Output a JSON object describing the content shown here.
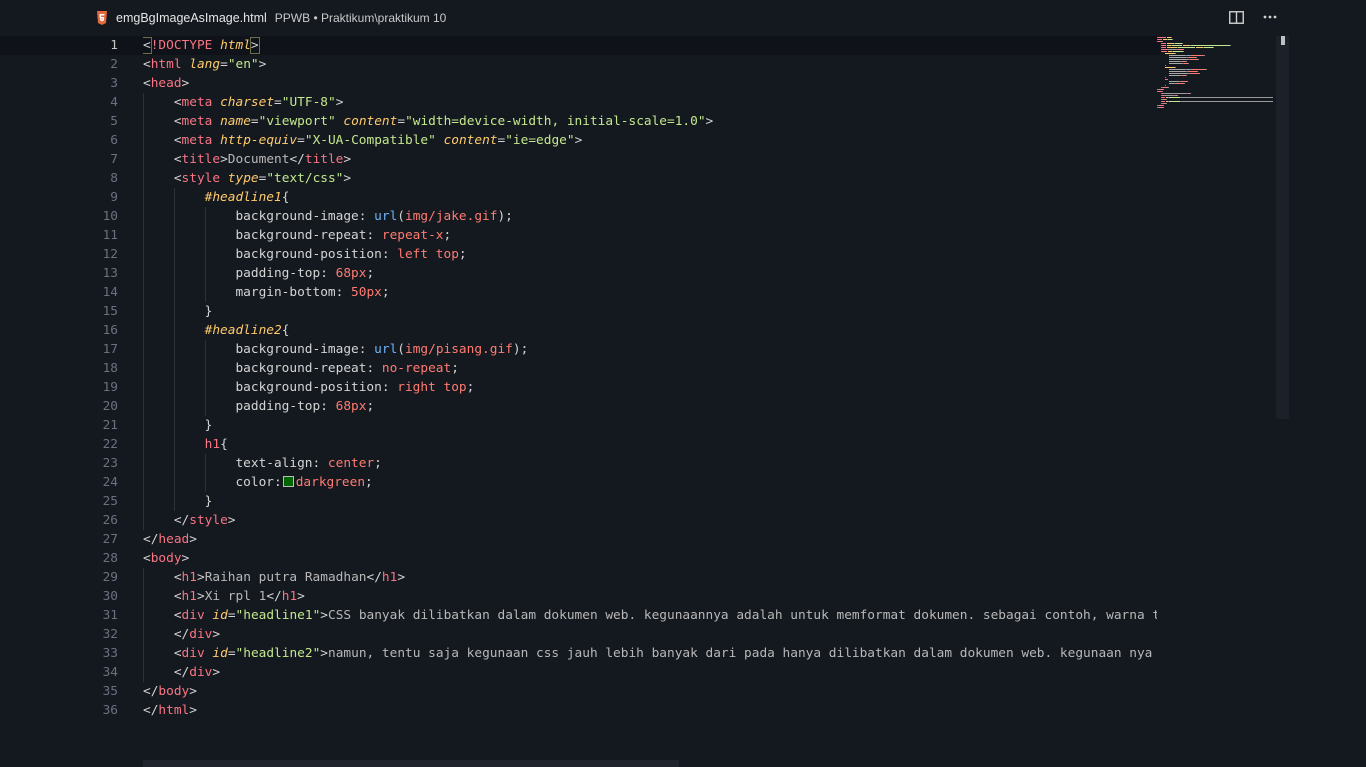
{
  "tab": {
    "filename": "emgBgImageAsImage.html",
    "path": "PPWB • Praktikum\\praktikum 10"
  },
  "toolbar": {
    "split_icon": "split-editor-icon",
    "more_icon": "more-actions-icon"
  },
  "colors": {
    "background": "#14181f",
    "tag": "#f97583",
    "attribute": "#ffcb6b",
    "string": "#c3e88d",
    "css_value": "#ff7b72",
    "css_function": "#6fb3f7",
    "darkgreen_swatch": "#006400"
  },
  "editor": {
    "active_line": 1,
    "lines": [
      {
        "num": "1",
        "tokens": [
          {
            "t": "<",
            "c": "punc",
            "m": 1
          },
          {
            "t": "!DOCTYPE",
            "c": "tag"
          },
          {
            "t": " "
          },
          {
            "t": "html",
            "c": "attr"
          },
          {
            "t": ">",
            "c": "punc",
            "m": 1
          }
        ]
      },
      {
        "num": "2",
        "tokens": [
          {
            "t": "<",
            "c": "punc"
          },
          {
            "t": "html",
            "c": "tag"
          },
          {
            "t": " "
          },
          {
            "t": "lang",
            "c": "attr"
          },
          {
            "t": "=",
            "c": "punc"
          },
          {
            "t": "\"en\"",
            "c": "str"
          },
          {
            "t": ">",
            "c": "punc"
          }
        ]
      },
      {
        "num": "3",
        "tokens": [
          {
            "t": "<",
            "c": "punc"
          },
          {
            "t": "head",
            "c": "tag"
          },
          {
            "t": ">",
            "c": "punc"
          }
        ]
      },
      {
        "num": "4",
        "tokens": [
          {
            "t": "    "
          },
          {
            "t": "<",
            "c": "punc"
          },
          {
            "t": "meta",
            "c": "tag"
          },
          {
            "t": " "
          },
          {
            "t": "charset",
            "c": "attr"
          },
          {
            "t": "=",
            "c": "punc"
          },
          {
            "t": "\"UTF-8\"",
            "c": "str"
          },
          {
            "t": ">",
            "c": "punc"
          }
        ]
      },
      {
        "num": "5",
        "tokens": [
          {
            "t": "    "
          },
          {
            "t": "<",
            "c": "punc"
          },
          {
            "t": "meta",
            "c": "tag"
          },
          {
            "t": " "
          },
          {
            "t": "name",
            "c": "attr"
          },
          {
            "t": "=",
            "c": "punc"
          },
          {
            "t": "\"viewport\"",
            "c": "str"
          },
          {
            "t": " "
          },
          {
            "t": "content",
            "c": "attr"
          },
          {
            "t": "=",
            "c": "punc"
          },
          {
            "t": "\"width=device-width, initial-scale=1.0\"",
            "c": "str"
          },
          {
            "t": ">",
            "c": "punc"
          }
        ]
      },
      {
        "num": "6",
        "tokens": [
          {
            "t": "    "
          },
          {
            "t": "<",
            "c": "punc"
          },
          {
            "t": "meta",
            "c": "tag"
          },
          {
            "t": " "
          },
          {
            "t": "http-equiv",
            "c": "attr"
          },
          {
            "t": "=",
            "c": "punc"
          },
          {
            "t": "\"X-UA-Compatible\"",
            "c": "str"
          },
          {
            "t": " "
          },
          {
            "t": "content",
            "c": "attr"
          },
          {
            "t": "=",
            "c": "punc"
          },
          {
            "t": "\"ie=edge\"",
            "c": "str"
          },
          {
            "t": ">",
            "c": "punc"
          }
        ]
      },
      {
        "num": "7",
        "tokens": [
          {
            "t": "    "
          },
          {
            "t": "<",
            "c": "punc"
          },
          {
            "t": "title",
            "c": "tag"
          },
          {
            "t": ">",
            "c": "punc"
          },
          {
            "t": "Document",
            "c": "text"
          },
          {
            "t": "</",
            "c": "punc"
          },
          {
            "t": "title",
            "c": "tag"
          },
          {
            "t": ">",
            "c": "punc"
          }
        ]
      },
      {
        "num": "8",
        "tokens": [
          {
            "t": "    "
          },
          {
            "t": "<",
            "c": "punc"
          },
          {
            "t": "style",
            "c": "tag"
          },
          {
            "t": " "
          },
          {
            "t": "type",
            "c": "attr"
          },
          {
            "t": "=",
            "c": "punc"
          },
          {
            "t": "\"text/css\"",
            "c": "str"
          },
          {
            "t": ">",
            "c": "punc"
          }
        ]
      },
      {
        "num": "9",
        "tokens": [
          {
            "t": "        "
          },
          {
            "t": "#headline1",
            "c": "sel"
          },
          {
            "t": "{",
            "c": "punc"
          }
        ]
      },
      {
        "num": "10",
        "tokens": [
          {
            "t": "            "
          },
          {
            "t": "background-image",
            "c": "prop"
          },
          {
            "t": ": ",
            "c": "punc"
          },
          {
            "t": "url",
            "c": "fn"
          },
          {
            "t": "(",
            "c": "punc"
          },
          {
            "t": "img/jake.gif",
            "c": "val"
          },
          {
            "t": ");",
            "c": "punc"
          }
        ]
      },
      {
        "num": "11",
        "tokens": [
          {
            "t": "            "
          },
          {
            "t": "background-repeat",
            "c": "prop"
          },
          {
            "t": ": ",
            "c": "punc"
          },
          {
            "t": "repeat-x",
            "c": "val"
          },
          {
            "t": ";",
            "c": "punc"
          }
        ]
      },
      {
        "num": "12",
        "tokens": [
          {
            "t": "            "
          },
          {
            "t": "background-position",
            "c": "prop"
          },
          {
            "t": ": ",
            "c": "punc"
          },
          {
            "t": "left top",
            "c": "val"
          },
          {
            "t": ";",
            "c": "punc"
          }
        ]
      },
      {
        "num": "13",
        "tokens": [
          {
            "t": "            "
          },
          {
            "t": "padding-top",
            "c": "prop"
          },
          {
            "t": ": ",
            "c": "punc"
          },
          {
            "t": "68px",
            "c": "val"
          },
          {
            "t": ";",
            "c": "punc"
          }
        ]
      },
      {
        "num": "14",
        "tokens": [
          {
            "t": "            "
          },
          {
            "t": "margin-bottom",
            "c": "prop"
          },
          {
            "t": ": ",
            "c": "punc"
          },
          {
            "t": "50px",
            "c": "val"
          },
          {
            "t": ";",
            "c": "punc"
          }
        ]
      },
      {
        "num": "15",
        "tokens": [
          {
            "t": "        "
          },
          {
            "t": "}",
            "c": "punc"
          }
        ]
      },
      {
        "num": "16",
        "tokens": [
          {
            "t": "        "
          },
          {
            "t": "#headline2",
            "c": "sel"
          },
          {
            "t": "{",
            "c": "punc"
          }
        ]
      },
      {
        "num": "17",
        "tokens": [
          {
            "t": "            "
          },
          {
            "t": "background-image",
            "c": "prop"
          },
          {
            "t": ": ",
            "c": "punc"
          },
          {
            "t": "url",
            "c": "fn"
          },
          {
            "t": "(",
            "c": "punc"
          },
          {
            "t": "img/pisang.gif",
            "c": "val"
          },
          {
            "t": ");",
            "c": "punc"
          }
        ]
      },
      {
        "num": "18",
        "tokens": [
          {
            "t": "            "
          },
          {
            "t": "background-repeat",
            "c": "prop"
          },
          {
            "t": ": ",
            "c": "punc"
          },
          {
            "t": "no-repeat",
            "c": "val"
          },
          {
            "t": ";",
            "c": "punc"
          }
        ]
      },
      {
        "num": "19",
        "tokens": [
          {
            "t": "            "
          },
          {
            "t": "background-position",
            "c": "prop"
          },
          {
            "t": ": ",
            "c": "punc"
          },
          {
            "t": "right top",
            "c": "val"
          },
          {
            "t": ";",
            "c": "punc"
          }
        ]
      },
      {
        "num": "20",
        "tokens": [
          {
            "t": "            "
          },
          {
            "t": "padding-top",
            "c": "prop"
          },
          {
            "t": ": ",
            "c": "punc"
          },
          {
            "t": "68px",
            "c": "val"
          },
          {
            "t": ";",
            "c": "punc"
          }
        ]
      },
      {
        "num": "21",
        "tokens": [
          {
            "t": "        "
          },
          {
            "t": "}",
            "c": "punc"
          }
        ]
      },
      {
        "num": "22",
        "tokens": [
          {
            "t": "        "
          },
          {
            "t": "h1",
            "c": "tag"
          },
          {
            "t": "{",
            "c": "punc"
          }
        ]
      },
      {
        "num": "23",
        "tokens": [
          {
            "t": "            "
          },
          {
            "t": "text-align",
            "c": "prop"
          },
          {
            "t": ": ",
            "c": "punc"
          },
          {
            "t": "center",
            "c": "val"
          },
          {
            "t": ";",
            "c": "punc"
          }
        ]
      },
      {
        "num": "24",
        "tokens": [
          {
            "t": "            "
          },
          {
            "t": "color",
            "c": "prop"
          },
          {
            "t": ":",
            "c": "punc"
          },
          {
            "t": "",
            "c": "swatch"
          },
          {
            "t": "darkgreen",
            "c": "val"
          },
          {
            "t": ";",
            "c": "punc"
          }
        ]
      },
      {
        "num": "25",
        "tokens": [
          {
            "t": "        "
          },
          {
            "t": "}",
            "c": "punc"
          }
        ]
      },
      {
        "num": "26",
        "tokens": [
          {
            "t": "    "
          },
          {
            "t": "</",
            "c": "punc"
          },
          {
            "t": "style",
            "c": "tag"
          },
          {
            "t": ">",
            "c": "punc"
          }
        ]
      },
      {
        "num": "27",
        "tokens": [
          {
            "t": "</",
            "c": "punc"
          },
          {
            "t": "head",
            "c": "tag"
          },
          {
            "t": ">",
            "c": "punc"
          }
        ]
      },
      {
        "num": "28",
        "tokens": [
          {
            "t": "<",
            "c": "punc"
          },
          {
            "t": "body",
            "c": "tag"
          },
          {
            "t": ">",
            "c": "punc"
          }
        ]
      },
      {
        "num": "29",
        "tokens": [
          {
            "t": "    "
          },
          {
            "t": "<",
            "c": "punc"
          },
          {
            "t": "h1",
            "c": "tag"
          },
          {
            "t": ">",
            "c": "punc"
          },
          {
            "t": "Raihan putra Ramadhan",
            "c": "text"
          },
          {
            "t": "</",
            "c": "punc"
          },
          {
            "t": "h1",
            "c": "tag"
          },
          {
            "t": ">",
            "c": "punc"
          }
        ]
      },
      {
        "num": "30",
        "tokens": [
          {
            "t": "    "
          },
          {
            "t": "<",
            "c": "punc"
          },
          {
            "t": "h1",
            "c": "tag"
          },
          {
            "t": ">",
            "c": "punc"
          },
          {
            "t": "Xi rpl 1",
            "c": "text"
          },
          {
            "t": "</",
            "c": "punc"
          },
          {
            "t": "h1",
            "c": "tag"
          },
          {
            "t": ">",
            "c": "punc"
          }
        ]
      },
      {
        "num": "31",
        "tokens": [
          {
            "t": "    "
          },
          {
            "t": "<",
            "c": "punc"
          },
          {
            "t": "div",
            "c": "tag"
          },
          {
            "t": " "
          },
          {
            "t": "id",
            "c": "attr"
          },
          {
            "t": "=",
            "c": "punc"
          },
          {
            "t": "\"headline1\"",
            "c": "str"
          },
          {
            "t": ">",
            "c": "punc"
          },
          {
            "t": "CSS banyak dilibatkan dalam dokumen web. kegunaannya adalah untuk memformat dokumen. sebagai contoh, warna t",
            "c": "text"
          }
        ]
      },
      {
        "num": "32",
        "tokens": [
          {
            "t": "    "
          },
          {
            "t": "</",
            "c": "punc"
          },
          {
            "t": "div",
            "c": "tag"
          },
          {
            "t": ">",
            "c": "punc"
          }
        ]
      },
      {
        "num": "33",
        "tokens": [
          {
            "t": "    "
          },
          {
            "t": "<",
            "c": "punc"
          },
          {
            "t": "div",
            "c": "tag"
          },
          {
            "t": " "
          },
          {
            "t": "id",
            "c": "attr"
          },
          {
            "t": "=",
            "c": "punc"
          },
          {
            "t": "\"headline2\"",
            "c": "str"
          },
          {
            "t": ">",
            "c": "punc"
          },
          {
            "t": "namun, tentu saja kegunaan css jauh lebih banyak dari pada hanya dilibatkan dalam dokumen web. kegunaan nya",
            "c": "text"
          }
        ]
      },
      {
        "num": "34",
        "tokens": [
          {
            "t": "    "
          },
          {
            "t": "</",
            "c": "punc"
          },
          {
            "t": "div",
            "c": "tag"
          },
          {
            "t": ">",
            "c": "punc"
          }
        ]
      },
      {
        "num": "35",
        "tokens": [
          {
            "t": "</",
            "c": "punc"
          },
          {
            "t": "body",
            "c": "tag"
          },
          {
            "t": ">",
            "c": "punc"
          }
        ]
      },
      {
        "num": "36",
        "tokens": [
          {
            "t": "</",
            "c": "punc"
          },
          {
            "t": "html",
            "c": "tag"
          },
          {
            "t": ">",
            "c": "punc"
          }
        ]
      }
    ]
  }
}
